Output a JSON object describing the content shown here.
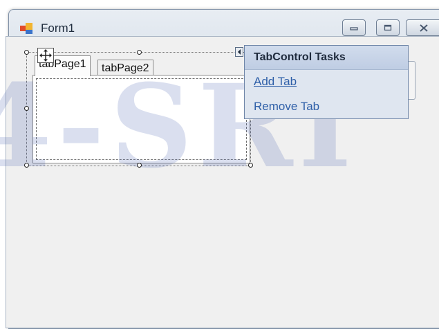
{
  "window": {
    "title": "Form1",
    "controls": {
      "minimize_icon": "minimize-icon",
      "maximize_icon": "maximize-icon",
      "close_icon": "close-icon"
    }
  },
  "tab_control": {
    "tabs": [
      {
        "label": "tabPage1",
        "selected": true
      },
      {
        "label": "tabPage2",
        "selected": false
      }
    ]
  },
  "tasks_panel": {
    "title": "TabControl Tasks",
    "items": [
      {
        "label": "Add Tab"
      },
      {
        "label": "Remove Tab"
      }
    ]
  },
  "watermark": {
    "text": "4-SRI"
  },
  "colors": {
    "accent": "#2e5fa8",
    "watermark": "#465faf",
    "client_background": "#f0f0f0",
    "titlebar": "#dfe6ee"
  }
}
